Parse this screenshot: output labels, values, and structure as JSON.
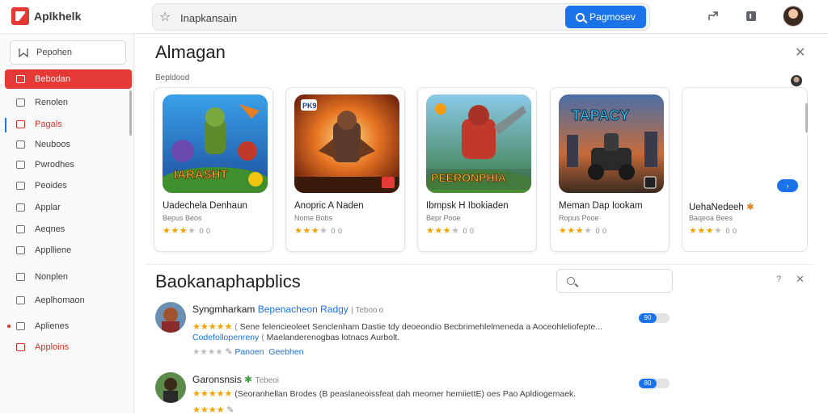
{
  "header": {
    "logo_text": "Aplkhelk",
    "search_value": "Inapkansain",
    "search_button": "Pagmosev"
  },
  "sidebar": {
    "search_label": "Pepohen",
    "items": [
      {
        "label": "Bebodan",
        "active": true
      },
      {
        "label": "Renolen"
      },
      {
        "label": "Pagals"
      },
      {
        "label": "Neuboos"
      },
      {
        "label": "Pwrodhes"
      },
      {
        "label": "Peoides"
      },
      {
        "label": "Applar"
      },
      {
        "label": "Aeqnes"
      },
      {
        "label": "Applliene"
      },
      {
        "label": "Nonplen"
      },
      {
        "label": "Aeplhomaon"
      },
      {
        "label": "Aplienes"
      },
      {
        "label": "Apploins"
      }
    ]
  },
  "featured": {
    "title": "Almagan",
    "subtitle": "Bepldood",
    "cards": [
      {
        "title": "Uadechela Denhaun",
        "sub": "Bepus Beos",
        "rating": 3.5,
        "meta": "0 0",
        "art_text": "IARASHT"
      },
      {
        "title": "Anopric A Naden",
        "sub": "Nome Bobs",
        "rating": 3.5,
        "meta": "0 0",
        "art_text": "PK9"
      },
      {
        "title": "Ibmpsk H Ibokiaden",
        "sub": "Bepr Pooe",
        "rating": 3.5,
        "meta": "0 0",
        "art_text": "PEERONPHIA"
      },
      {
        "title": "Meman Dap Iookam",
        "sub": "Ropus Pooe",
        "rating": 3,
        "meta": "0 0",
        "art_text": "TAPACY"
      },
      {
        "title": "UehaNedeeh",
        "sub": "Baqeoa Bees",
        "rating": 3.5,
        "meta": "0 0"
      }
    ],
    "next_label": "›"
  },
  "reviews": {
    "title": "Baokanaphapblics",
    "reviews": [
      {
        "name": "Syngmharkam",
        "handle": "Bepenacheon Radgy",
        "meta": "| Teboo o",
        "line1": "Sene felencieoleet Senclenham Dastie tdy deoeondio Becbrimehlelmeneda a Aoceohleliofepte...",
        "line2_link": "Codefollopenreny",
        "line2": "Maelanderenogbas lotnacs Aurbolt.",
        "line3_link": "Panoen",
        "line3_link2": "Geebhen",
        "toggle": "90"
      },
      {
        "name": "Garonsnsis",
        "handle": "",
        "meta": "Tebeoi",
        "line1": "(Seoranhellan Brodes (B peaslaneoissfeat dah meomer hemiiettE) oes Pao Apldiogemaek.",
        "toggle": "80"
      }
    ]
  },
  "colors": {
    "accent_blue": "#1a73e8",
    "brand_red": "#e53935",
    "star": "#f4a300"
  }
}
